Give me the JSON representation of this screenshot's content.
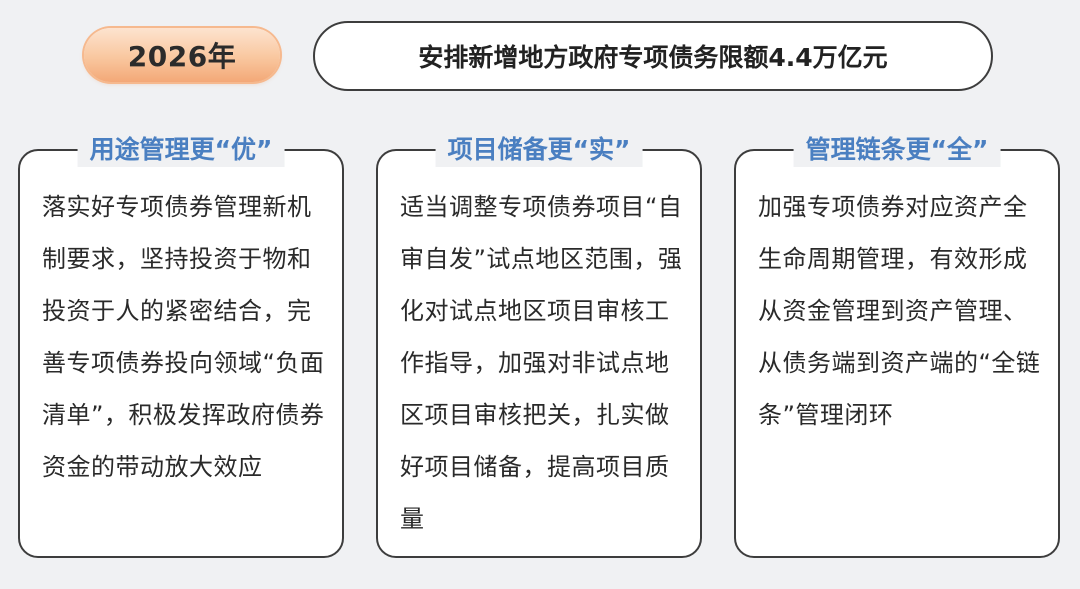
{
  "year_badge": {
    "label": "2026年"
  },
  "headline": {
    "text": "安排新增地方政府专项债务限额4.4万亿元"
  },
  "cards": [
    {
      "title": "用途管理更“优”",
      "body": "落实好专项债券管理新机制要求，坚持投资于物和投资于人的紧密结合，完善专项债券投向领域“负面清单”，积极发挥政府债券资金的带动放大效应"
    },
    {
      "title": "项目储备更“实”",
      "body": "适当调整专项债券项目“自审自发”试点地区范围，强化对试点地区项目审核工作指导，加强对非试点地区项目审核把关，扎实做好项目储备，提高项目质量"
    },
    {
      "title": "管理链条更“全”",
      "body": "加强专项债券对应资产全生命周期管理，有效形成从资金管理到资产管理、从债务端到资产端的“全链条”管理闭环"
    }
  ],
  "colors": {
    "title_blue": "#4a7fc1",
    "badge_orange": "#f9c79f",
    "border_dark": "#3d3d3d",
    "background": "#f0f1f3"
  }
}
